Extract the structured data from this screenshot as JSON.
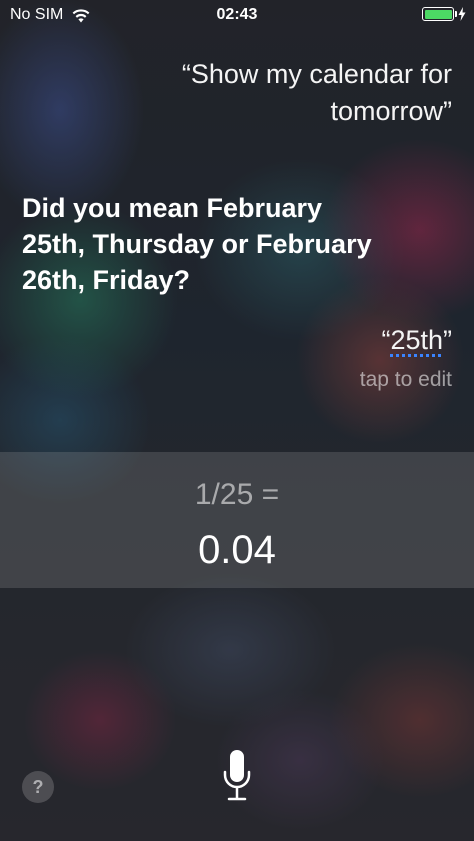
{
  "status_bar": {
    "carrier": "No SIM",
    "time": "02:43",
    "wifi_icon": "wifi-icon",
    "battery_icon": "battery-icon",
    "charging_icon": "bolt-icon",
    "battery_color": "#4cd964"
  },
  "siri": {
    "user_query": "“Show my calendar for tomorrow”",
    "response": "Did you mean February 25th, Thursday or February 26th, Friday?",
    "reply_open_quote": "“",
    "reply_word": "25th",
    "reply_close_quote": "”",
    "tap_to_edit": "tap to edit"
  },
  "calculation": {
    "expression": "1/25 =",
    "result": "0.04"
  },
  "controls": {
    "help_label": "?",
    "help_icon": "question-icon",
    "mic_icon": "microphone-icon"
  }
}
